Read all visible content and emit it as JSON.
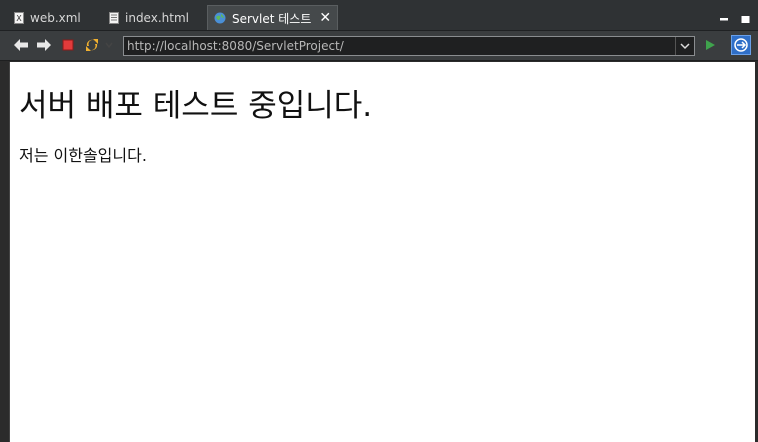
{
  "tabs": [
    {
      "label": "web.xml",
      "icon": "xml-file-icon",
      "active": false
    },
    {
      "label": "index.html",
      "icon": "html-file-icon",
      "active": false
    },
    {
      "label": "Servlet 테스트",
      "icon": "globe-icon",
      "active": true
    }
  ],
  "toolbar": {
    "back_icon": "back-arrow-icon",
    "forward_icon": "forward-arrow-icon",
    "stop_icon": "stop-icon",
    "refresh_icon": "refresh-icon",
    "go_icon": "go-play-icon",
    "browser_icon": "browser-icon"
  },
  "address": {
    "url": "http://localhost:8080/ServletProject/"
  },
  "page": {
    "heading": "서버 배포 테스트 중입니다.",
    "paragraph": "저는 이한솔입니다."
  },
  "colors": {
    "background_dark": "#2b2b2b",
    "tabbar": "#2f3234",
    "active_tab": "#45494b",
    "stop_red": "#e23b3b",
    "go_green": "#3fa34d",
    "content_bg": "#ffffff"
  }
}
